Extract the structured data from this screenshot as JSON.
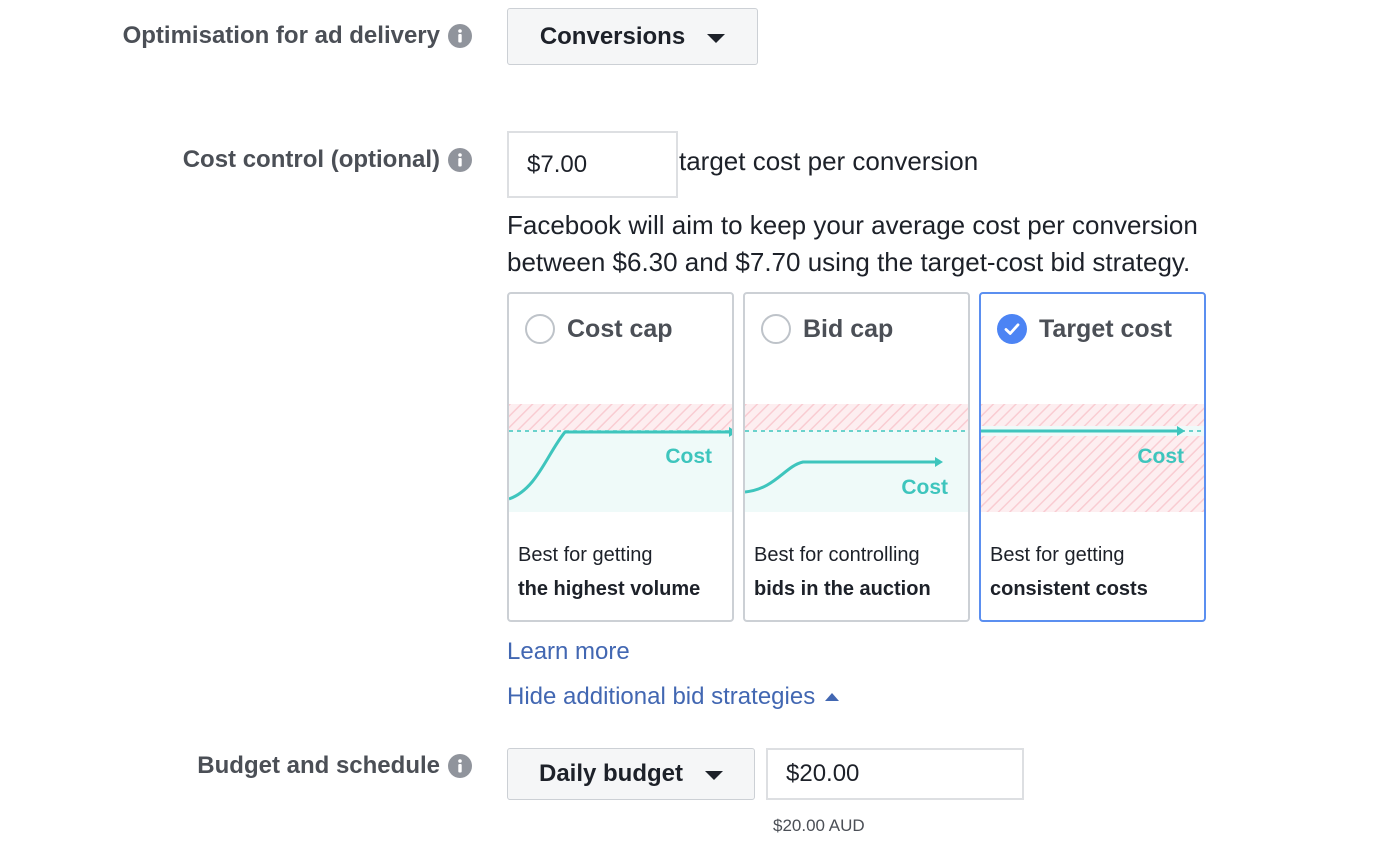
{
  "optimisation": {
    "label": "Optimisation for ad delivery",
    "selected": "Conversions"
  },
  "cost_control": {
    "label": "Cost control (optional)",
    "value": "$7.00",
    "suffix": "target cost per conversion",
    "description": "Facebook will aim to keep your average cost per conversion between $6.30 and $7.70 using the target-cost bid strategy."
  },
  "strategies": [
    {
      "title": "Cost cap",
      "selected": false,
      "graph_label": "Cost",
      "line1": "Best for getting",
      "line2": "the highest volume"
    },
    {
      "title": "Bid cap",
      "selected": false,
      "graph_label": "Cost",
      "line1": "Best for controlling",
      "line2": "bids in the auction"
    },
    {
      "title": "Target cost",
      "selected": true,
      "graph_label": "Cost",
      "line1": "Best for getting",
      "line2": "consistent costs"
    }
  ],
  "links": {
    "learn_more": "Learn more",
    "hide_strategies": "Hide additional bid strategies"
  },
  "budget": {
    "label": "Budget and schedule",
    "type": "Daily budget",
    "value": "$20.00",
    "converted": "$20.00 AUD"
  },
  "colors": {
    "teal": "#3ec5bd",
    "band_red": "#fbd9dc",
    "accent_blue": "#4c84f4",
    "link": "#4267b2"
  },
  "icons": {
    "info": "info-icon",
    "caret": "caret-down-icon",
    "check": "checkmark-icon"
  }
}
